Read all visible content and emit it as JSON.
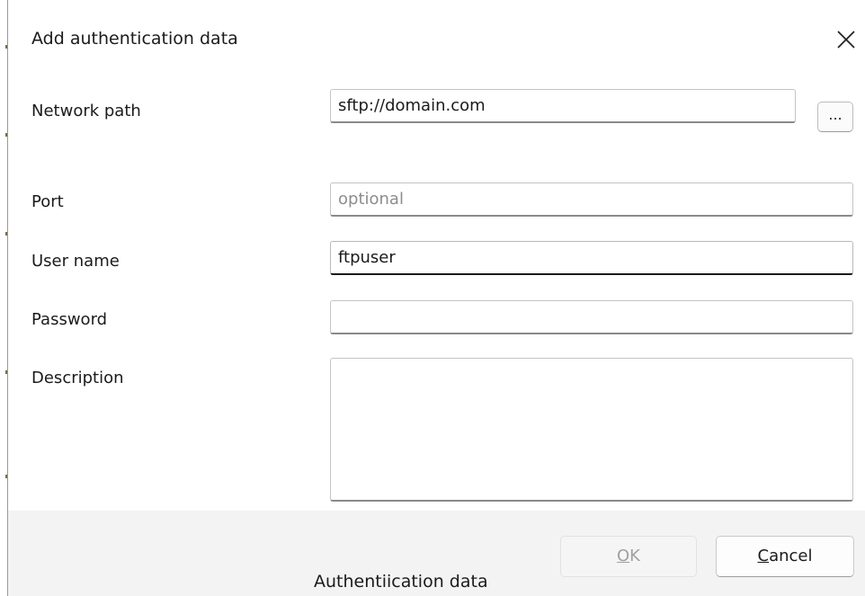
{
  "dialog": {
    "title": "Add authentication data",
    "close_glyph": "close-icon"
  },
  "form": {
    "network_path": {
      "label": "Network path",
      "value": "sftp://domain.com",
      "browse_label": "..."
    },
    "port": {
      "label": "Port",
      "value": "",
      "placeholder": "optional"
    },
    "user_name": {
      "label": "User name",
      "value": "ftpuser"
    },
    "password": {
      "label": "Password",
      "value": ""
    },
    "description": {
      "label": "Description",
      "value": ""
    }
  },
  "buttons": {
    "ok_first": "O",
    "ok_rest": "K",
    "cancel_first": "C",
    "cancel_rest": "ancel"
  },
  "caption": "Authentiication data",
  "colors": {
    "footer_bg": "#f3f3f3",
    "disabled_text": "#a0a0a0",
    "placeholder_text": "#8d8d8d"
  }
}
